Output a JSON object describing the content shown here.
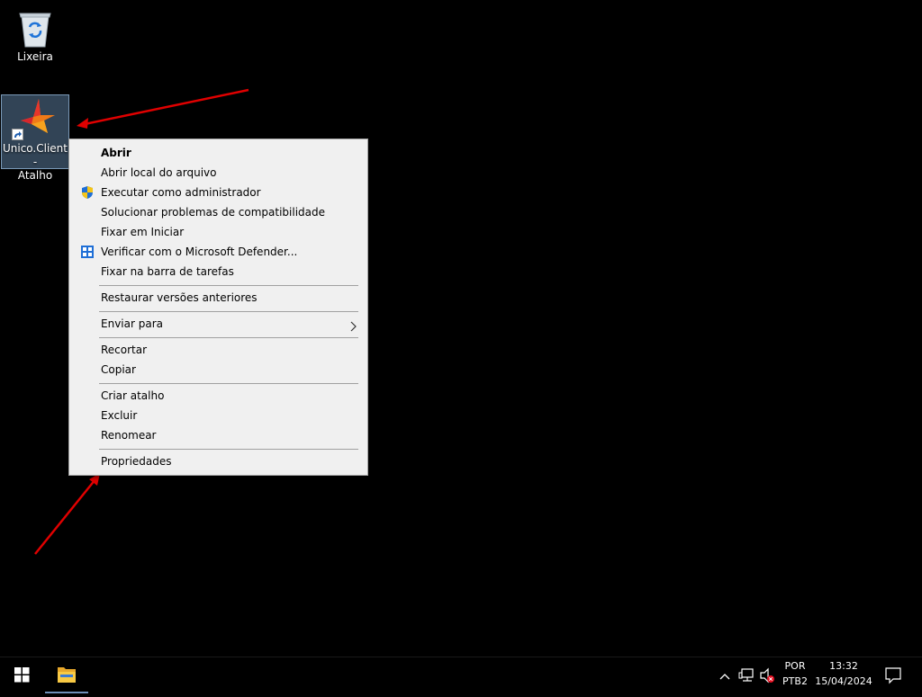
{
  "desktop": {
    "icons": [
      {
        "label": "Lixeira"
      },
      {
        "label_line1": "Unico.Client -",
        "label_line2": "Atalho"
      }
    ]
  },
  "context_menu": {
    "items": [
      {
        "label": "Abrir",
        "bold": true
      },
      {
        "label": "Abrir local do arquivo"
      },
      {
        "label": "Executar como administrador",
        "icon": "uac-shield-icon"
      },
      {
        "label": "Solucionar problemas de compatibilidade"
      },
      {
        "label": "Fixar em Iniciar"
      },
      {
        "label": "Verificar com o Microsoft Defender...",
        "icon": "defender-icon"
      },
      {
        "label": "Fixar na barra de tarefas"
      },
      {
        "label": "Restaurar versões anteriores"
      },
      {
        "label": "Enviar para",
        "submenu": true
      },
      {
        "label": "Recortar"
      },
      {
        "label": "Copiar"
      },
      {
        "label": "Criar atalho"
      },
      {
        "label": "Excluir"
      },
      {
        "label": "Renomear"
      },
      {
        "label": "Propriedades"
      }
    ]
  },
  "taskbar": {
    "language_line1": "POR",
    "language_line2": "PTB2",
    "time": "13:32",
    "date": "15/04/2024"
  },
  "colors": {
    "desktop_bg": "#000000",
    "menu_bg": "#f0f0f0",
    "annotation_arrow": "#e00000",
    "selection_bg": "#6e96be"
  }
}
